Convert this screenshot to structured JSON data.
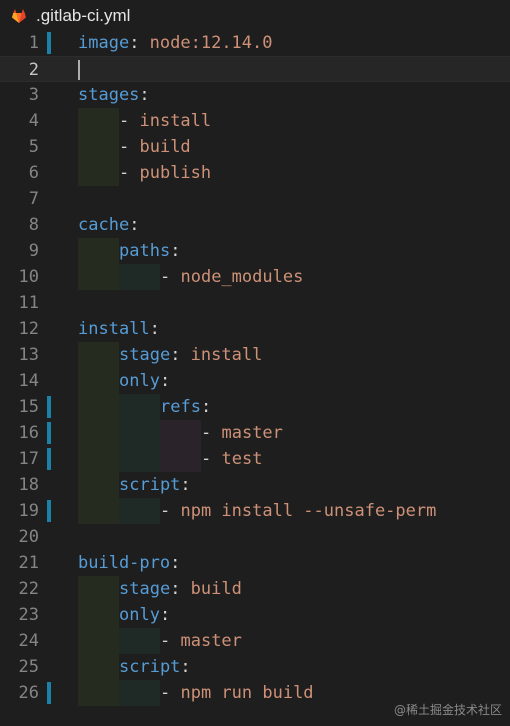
{
  "tab": {
    "title": ".gitlab-ci.yml",
    "icon": "gitlab-icon"
  },
  "colors": {
    "key": "#569cd6",
    "value": "#ce9178",
    "punct": "#d4d4d4",
    "gutter_marker": "#1b81a8"
  },
  "lines": [
    {
      "n": "1",
      "key": "image",
      "colon": ":",
      "value": " node:12.14.0"
    },
    {
      "n": "2",
      "text": ""
    },
    {
      "n": "3",
      "key": "stages",
      "colon": ":"
    },
    {
      "n": "4",
      "dash": "- ",
      "value": "install"
    },
    {
      "n": "5",
      "dash": "- ",
      "value": "build"
    },
    {
      "n": "6",
      "dash": "- ",
      "value": "publish"
    },
    {
      "n": "7",
      "text": ""
    },
    {
      "n": "8",
      "key": "cache",
      "colon": ":"
    },
    {
      "n": "9",
      "key": "paths",
      "colon": ":"
    },
    {
      "n": "10",
      "dash": "- ",
      "value": "node_modules"
    },
    {
      "n": "11",
      "text": ""
    },
    {
      "n": "12",
      "key": "install",
      "colon": ":"
    },
    {
      "n": "13",
      "key": "stage",
      "colon": ":",
      "value": " install"
    },
    {
      "n": "14",
      "key": "only",
      "colon": ":"
    },
    {
      "n": "15",
      "key": "refs",
      "colon": ":"
    },
    {
      "n": "16",
      "dash": "- ",
      "value": "master"
    },
    {
      "n": "17",
      "dash": "- ",
      "value": "test"
    },
    {
      "n": "18",
      "key": "script",
      "colon": ":"
    },
    {
      "n": "19",
      "dash": "- ",
      "value": "npm install --unsafe-perm"
    },
    {
      "n": "20",
      "text": ""
    },
    {
      "n": "21",
      "key": "build-pro",
      "colon": ":"
    },
    {
      "n": "22",
      "key": "stage",
      "colon": ":",
      "value": " build"
    },
    {
      "n": "23",
      "key": "only",
      "colon": ":"
    },
    {
      "n": "24",
      "dash": "- ",
      "value": "master"
    },
    {
      "n": "25",
      "key": "script",
      "colon": ":"
    },
    {
      "n": "26",
      "dash": "- ",
      "value": "npm run build"
    }
  ],
  "watermark": "@稀土掘金技术社区"
}
